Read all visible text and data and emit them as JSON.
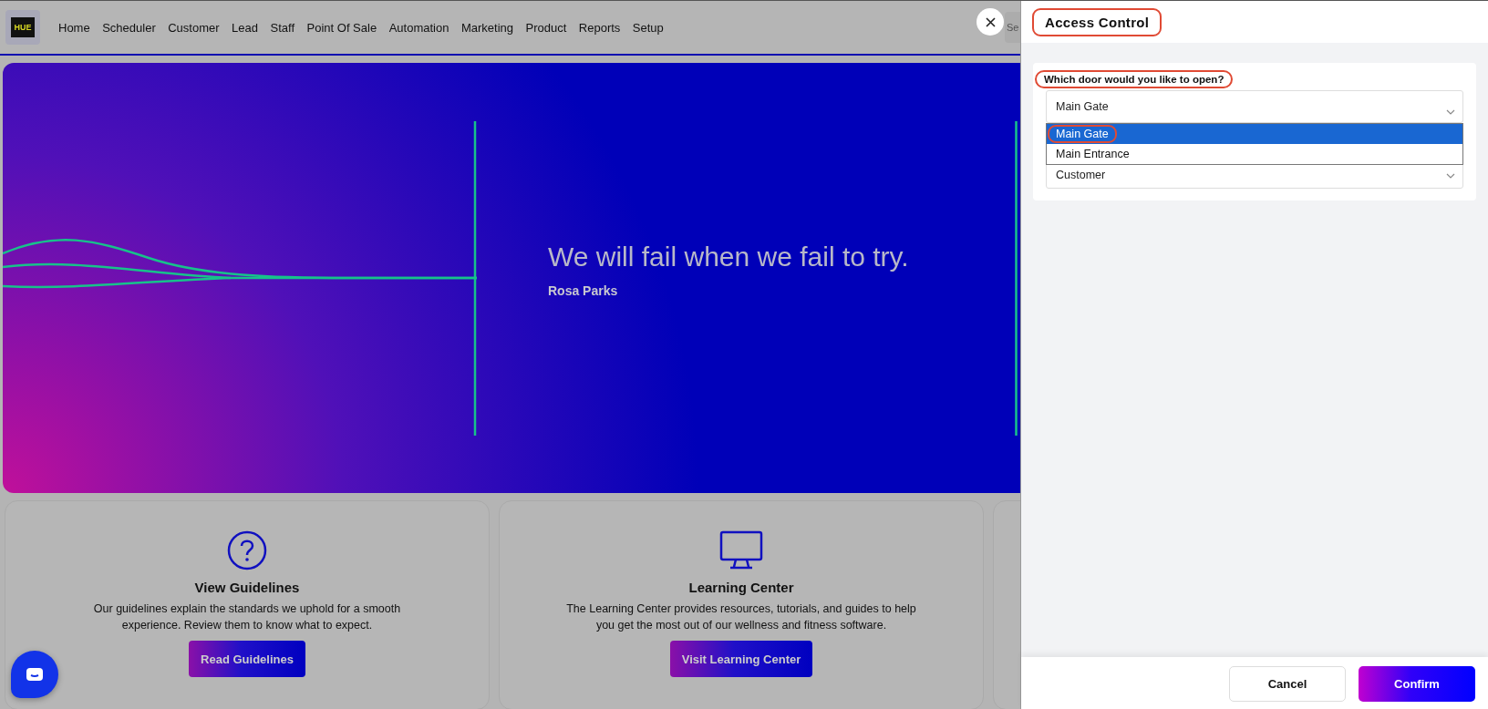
{
  "nav": {
    "logo_text": "HUE",
    "items": [
      {
        "label": "Home"
      },
      {
        "label": "Scheduler"
      },
      {
        "label": "Customer"
      },
      {
        "label": "Lead"
      },
      {
        "label": "Staff"
      },
      {
        "label": "Point Of Sale"
      },
      {
        "label": "Automation"
      },
      {
        "label": "Marketing"
      },
      {
        "label": "Product"
      },
      {
        "label": "Reports"
      },
      {
        "label": "Setup"
      }
    ],
    "search": {
      "placeholder": "Se"
    }
  },
  "hero": {
    "quote": "We will fail when we fail to try.",
    "author": "Rosa Parks"
  },
  "cards": [
    {
      "kind": "help",
      "title": "View Guidelines",
      "text": "Our guidelines explain the standards we uphold for a smooth experience. Review them to know what to expect.",
      "button": "Read Guidelines"
    },
    {
      "kind": "monitor",
      "title": "Learning Center",
      "text": "The Learning Center provides resources, tutorials, and guides to help you get the most out of our wellness and fitness software.",
      "button": "Visit Learning Center"
    },
    {
      "kind": "hidden"
    }
  ],
  "drawer": {
    "title": "Access Control",
    "title_highlighted": true,
    "fields": [
      {
        "label": "Which door would you like to open?",
        "label_highlighted": true,
        "value": "Main Gate",
        "expanded": true,
        "options": [
          {
            "label": "Main Gate",
            "selected": true,
            "highlighted": true
          },
          {
            "label": "Main Entrance",
            "selected": false,
            "highlighted": false
          }
        ]
      },
      {
        "value": "Customer"
      }
    ],
    "buttons": [
      {
        "kind": "secondary",
        "label": "Cancel"
      },
      {
        "kind": "primary",
        "label": "Confirm"
      }
    ]
  }
}
